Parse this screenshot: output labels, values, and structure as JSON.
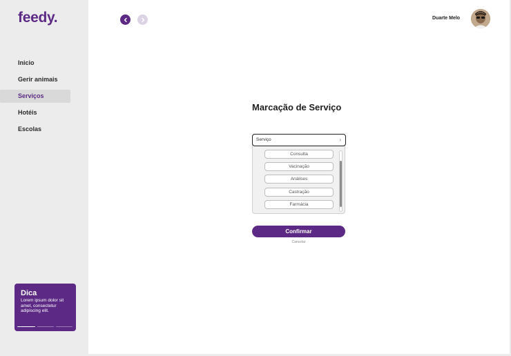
{
  "app": {
    "logo": "feedy."
  },
  "sidebar": {
    "items": [
      {
        "label": "Inicio",
        "active": false
      },
      {
        "label": "Gerir animais",
        "active": false
      },
      {
        "label": "Serviços",
        "active": true
      },
      {
        "label": "Hotéis",
        "active": false
      },
      {
        "label": "Escolas",
        "active": false
      }
    ],
    "tip": {
      "title": "Dica",
      "text": "Lorem ipsum dolor sit amet, consectetur adipiscing elit."
    }
  },
  "header": {
    "user_name": "Duarte Melo"
  },
  "main": {
    "title": "Marcação de Serviço",
    "service_select": {
      "value": "Serviço",
      "options": [
        "Consulta",
        "Vacinação",
        "Análises",
        "Castração",
        "Farmácia"
      ]
    },
    "confirm_label": "Confirmar",
    "cancel_label": "Cancelar"
  },
  "colors": {
    "accent": "#5c2a84",
    "accent_light": "#dcd3e4",
    "sidebar_bg": "#ececec"
  }
}
